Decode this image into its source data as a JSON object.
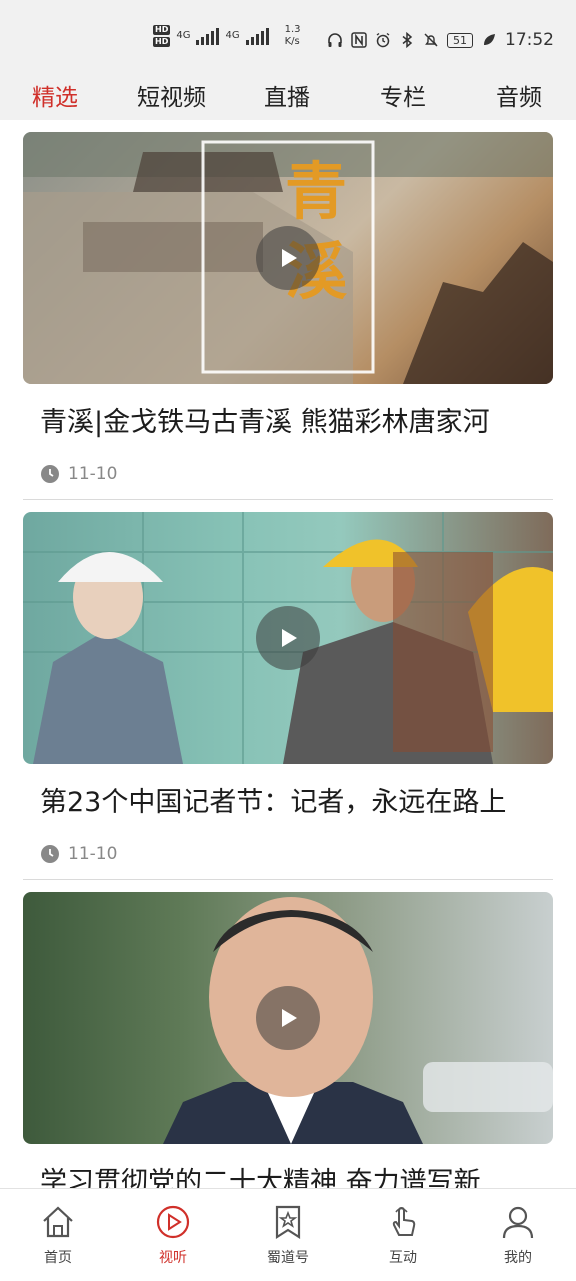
{
  "status_bar": {
    "hd1": "HD",
    "hd2": "HD",
    "net1": "4G",
    "net2": "4G",
    "speed_value": "1.3",
    "speed_unit": "K/s",
    "battery": "51",
    "time": "17:52"
  },
  "tabs": [
    {
      "label": "精选",
      "active": true
    },
    {
      "label": "短视频",
      "active": false
    },
    {
      "label": "直播",
      "active": false
    },
    {
      "label": "专栏",
      "active": false
    },
    {
      "label": "音频",
      "active": false
    }
  ],
  "feed": [
    {
      "title": "青溪|金戈铁马古青溪 熊猫彩林唐家河",
      "date": "11-10",
      "overlay_text": "青溪"
    },
    {
      "title": "第23个中国记者节：记者，永远在路上",
      "date": "11-10"
    },
    {
      "title": "学习贯彻党的二十大精神 奋力谱写新"
    }
  ],
  "bottom_nav": [
    {
      "label": "首页",
      "icon": "home-icon",
      "active": false
    },
    {
      "label": "视听",
      "icon": "play-circle-icon",
      "active": true
    },
    {
      "label": "蜀道号",
      "icon": "bookmark-star-icon",
      "active": false
    },
    {
      "label": "互动",
      "icon": "hand-tap-icon",
      "active": false
    },
    {
      "label": "我的",
      "icon": "user-icon",
      "active": false
    }
  ],
  "colors": {
    "accent": "#d0302a",
    "tab_bar_bg": "#f1f1f1",
    "text": "#1c1c1c",
    "meta": "#888888"
  }
}
